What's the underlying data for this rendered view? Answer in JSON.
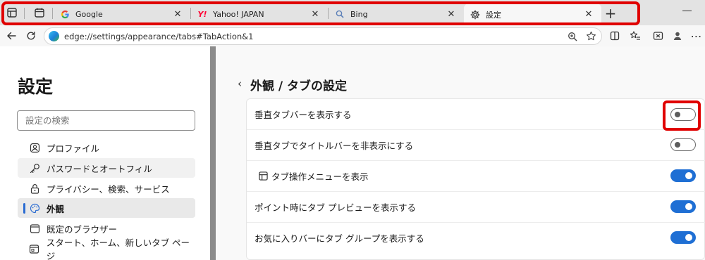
{
  "tabs": [
    {
      "title": "Google",
      "favicon": "google-g-icon",
      "active": false
    },
    {
      "title": "Yahoo! JAPAN",
      "favicon": "yahoo-y-icon",
      "active": false
    },
    {
      "title": "Bing",
      "favicon": "bing-search-icon",
      "active": false
    },
    {
      "title": "設定",
      "favicon": "gear-icon",
      "active": true
    }
  ],
  "address_bar": {
    "url": "edge://settings/appearance/tabs#TabAction&1"
  },
  "sidebar": {
    "title": "設定",
    "search_placeholder": "設定の検索",
    "items": [
      {
        "label": "プロファイル",
        "icon": "profile-icon"
      },
      {
        "label": "パスワードとオートフィル",
        "icon": "key-icon"
      },
      {
        "label": "プライバシー、検索、サービス",
        "icon": "lock-icon"
      },
      {
        "label": "外観",
        "icon": "appearance-icon"
      },
      {
        "label": "既定のブラウザー",
        "icon": "browser-window-icon"
      },
      {
        "label": "スタート、ホーム、新しいタブ ページ",
        "icon": "home-window-icon"
      }
    ]
  },
  "main": {
    "title": "外観 / タブの設定",
    "settings": [
      {
        "label": "垂直タブバーを表示する",
        "enabled": false
      },
      {
        "label": "垂直タブでタイトルバーを非表示にする",
        "enabled": false
      },
      {
        "label": "タブ操作メニューを表示",
        "enabled": true,
        "icon": "tab-actions-icon"
      },
      {
        "label": "ポイント時にタブ プレビューを表示する",
        "enabled": true
      },
      {
        "label": "お気に入りバーにタブ グループを表示する",
        "enabled": true
      }
    ]
  },
  "colors": {
    "accent": "#1f6fd4",
    "highlight": "#e00000"
  }
}
